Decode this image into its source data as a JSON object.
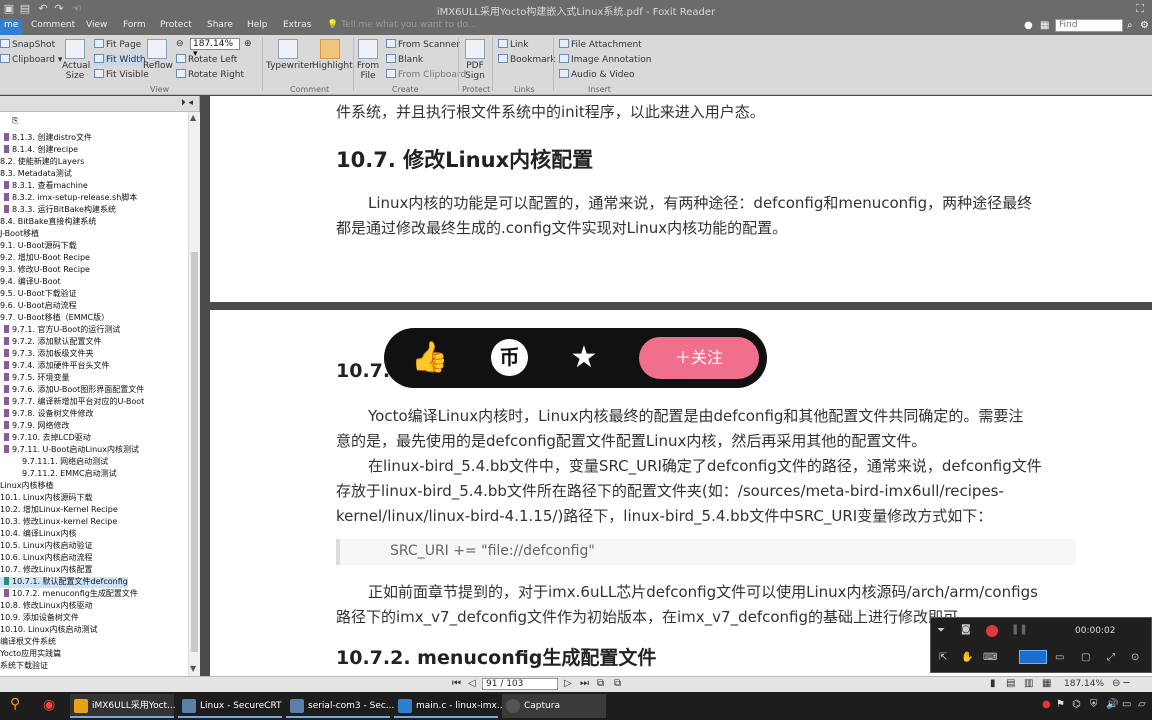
{
  "window": {
    "title": "iMX6ULL采用Yocto构建嵌入式Linux系统.pdf - Foxit Reader"
  },
  "tabs": [
    "me",
    "Comment",
    "View",
    "Form",
    "Protect",
    "Share",
    "Help",
    "Extras"
  ],
  "tell_me": "Tell me what you want to do...",
  "find_placeholder": "Find",
  "ribbon": {
    "snapshot": "SnapShot",
    "clipboard": "Clipboard",
    "actual_size": "Actual Size",
    "actual_size_l1": "Actual",
    "actual_size_l2": "Size",
    "fit_page": "Fit Page",
    "fit_width": "Fit Width",
    "fit_visible": "Fit Visible",
    "reflow": "Reflow",
    "zoom": "187.14%",
    "rotate_left": "Rotate Left",
    "rotate_right": "Rotate Right",
    "typewriter": "Typewriter",
    "highlight": "Highlight",
    "from_file_l1": "From",
    "from_file_l2": "File",
    "from_scanner": "From Scanner",
    "blank": "Blank",
    "from_clipboard": "From Clipboard",
    "pdf_sign_l1": "PDF",
    "pdf_sign_l2": "Sign",
    "link": "Link",
    "bookmark": "Bookmark",
    "file_attachment": "File Attachment",
    "image_annotation": "Image Annotation",
    "audio_video": "Audio & Video",
    "groups": {
      "view": "View",
      "comment": "Comment",
      "create": "Create",
      "protect": "Protect",
      "links": "Links",
      "insert": "Insert"
    }
  },
  "bookmarks": [
    {
      "label": "8.1.3. 创建distro文件",
      "indent": 2,
      "mark": true
    },
    {
      "label": "8.1.4. 创建recipe",
      "indent": 2,
      "mark": true
    },
    {
      "label": "8.2. 使能新建的Layers",
      "indent": 0,
      "mark": false
    },
    {
      "label": "8.3. Metadata测试",
      "indent": 0,
      "mark": false
    },
    {
      "label": "8.3.1. 查看machine",
      "indent": 2,
      "mark": true
    },
    {
      "label": "8.3.2. imx-setup-release.sh脚本",
      "indent": 2,
      "mark": true
    },
    {
      "label": "8.3.3. 运行BitBake构建系统",
      "indent": 2,
      "mark": true
    },
    {
      "label": "8.4. BitBake直接构建系统",
      "indent": 0,
      "mark": false
    },
    {
      "label": "J-Boot移植",
      "indent": 0,
      "mark": false
    },
    {
      "label": "9.1. U-Boot源码下载",
      "indent": 0,
      "mark": false
    },
    {
      "label": "9.2. 增加U-Boot Recipe",
      "indent": 0,
      "mark": false
    },
    {
      "label": "9.3. 修改U-Boot Recipe",
      "indent": 0,
      "mark": false
    },
    {
      "label": "9.4. 编译U-Boot",
      "indent": 0,
      "mark": false
    },
    {
      "label": "9.5. U-Boot下载验证",
      "indent": 0,
      "mark": false
    },
    {
      "label": "9.6. U-Boot启动流程",
      "indent": 0,
      "mark": false
    },
    {
      "label": "9.7. U-Boot移植（EMMC版）",
      "indent": 0,
      "mark": false
    },
    {
      "label": "9.7.1. 官方U-Boot的运行测试",
      "indent": 2,
      "mark": true
    },
    {
      "label": "9.7.2. 添加默认配置文件",
      "indent": 2,
      "mark": true
    },
    {
      "label": "9.7.3. 添加板级文件夹",
      "indent": 2,
      "mark": true
    },
    {
      "label": "9.7.4. 添加硬件平台头文件",
      "indent": 2,
      "mark": true
    },
    {
      "label": "9.7.5. 环境变量",
      "indent": 2,
      "mark": true
    },
    {
      "label": "9.7.6. 添加U-Boot图形界面配置文件",
      "indent": 2,
      "mark": true
    },
    {
      "label": "9.7.7. 编译新增加平台对应的U-Boot",
      "indent": 2,
      "mark": true
    },
    {
      "label": "9.7.8. 设备树文件修改",
      "indent": 2,
      "mark": true
    },
    {
      "label": "9.7.9. 网络修改",
      "indent": 2,
      "mark": true
    },
    {
      "label": "9.7.10. 去掉LCD驱动",
      "indent": 2,
      "mark": true
    },
    {
      "label": "9.7.11. U-Boot启动Linux内核测试",
      "indent": 2,
      "mark": true
    },
    {
      "label": "9.7.11.1. 网络启动测试",
      "indent": 4,
      "mark": false
    },
    {
      "label": "9.7.11.2. EMMC启动测试",
      "indent": 4,
      "mark": false
    },
    {
      "label": "Linux内核移植",
      "indent": 0,
      "mark": false
    },
    {
      "label": "10.1. Linux内核源码下载",
      "indent": 0,
      "mark": false
    },
    {
      "label": "10.2. 增加Linux-Kernel Recipe",
      "indent": 0,
      "mark": false
    },
    {
      "label": "10.3. 修改Linux-kernel Recipe",
      "indent": 0,
      "mark": false
    },
    {
      "label": "10.4. 编译Linux内核",
      "indent": 0,
      "mark": false
    },
    {
      "label": "10.5. Linux内核启动验证",
      "indent": 0,
      "mark": false
    },
    {
      "label": "10.6. Linux内核启动流程",
      "indent": 0,
      "mark": false
    },
    {
      "label": "10.7. 修改Linux内核配置",
      "indent": 0,
      "mark": false
    },
    {
      "label": "10.7.1. 默认配置文件defconfig",
      "indent": 2,
      "mark": true,
      "selected": true
    },
    {
      "label": "10.7.2. menuconfig生成配置文件",
      "indent": 2,
      "mark": true
    },
    {
      "label": "10.8. 修改Linux内核驱动",
      "indent": 0,
      "mark": false
    },
    {
      "label": "10.9. 添加设备树文件",
      "indent": 0,
      "mark": false
    },
    {
      "label": "10.10. Linux内核启动测试",
      "indent": 0,
      "mark": false
    },
    {
      "label": "编译根文件系统",
      "indent": 0,
      "mark": false
    },
    {
      "label": "Yocto应用实践篇",
      "indent": 0,
      "mark": false
    },
    {
      "label": "系统下载验证",
      "indent": 0,
      "mark": false
    }
  ],
  "doc": {
    "p1_line": "件系统，并且执行根文件系统中的init程序，以此来进入用户态。",
    "h_107": "10.7. 修改Linux内核配置",
    "p2_l1": "Linux内核的功能是可以配置的，通常来说，有两种途径：defconfig和menuconfig，两种途径最终",
    "p2_l2": "都是通过修改最终生成的.config文件实现对Linux内核功能的配置。",
    "h_1071_partial": "10.7.1",
    "p3_l1": "Yocto编译Linux内核时，Linux内核最终的配置是由defconfig和其他配置文件共同确定的。需要注",
    "p3_l2": "意的是，最先使用的是defconfig配置文件配置Linux内核，然后再采用其他的配置文件。",
    "p4_l1": "在linux-bird_5.4.bb文件中，变量SRC_URI确定了defconfig文件的路径，通常来说，defconfig文件",
    "p4_l2": "存放于linux-bird_5.4.bb文件所在路径下的配置文件夹(如：/sources/meta-bird-imx6ull/recipes-",
    "p4_l3": "kernel/linux/linux-bird-4.1.15/)路径下，linux-bird_5.4.bb文件中SRC_URI变量修改方式如下：",
    "code": "SRC_URI += \"file://defconfig\"",
    "p5_l1": "正如前面章节提到的，对于imx.6uLL芯片defconfig文件可以使用Linux内核源码/arch/arm/configs",
    "p5_l2": "路径下的imx_v7_defconfig文件作为初始版本，在imx_v7_defconfig的基础上进行修改即可。",
    "h_1072": "10.7.2. menuconfig生成配置文件"
  },
  "overlay": {
    "follow": "＋关注"
  },
  "recorder": {
    "time": "00:00:02"
  },
  "status": {
    "page": "91 / 103",
    "zoom": "187.14%"
  },
  "taskbar": [
    {
      "label": "iMX6ULL采用Yoct...",
      "color": "#e8a317"
    },
    {
      "label": "Linux - SecureCRT",
      "color": "#5a7fa8"
    },
    {
      "label": "serial-com3 - Sec...",
      "color": "#5a7fa8"
    },
    {
      "label": "main.c - linux-imx...",
      "color": "#2f7fd0"
    },
    {
      "label": "Captura",
      "color": "#555"
    }
  ]
}
